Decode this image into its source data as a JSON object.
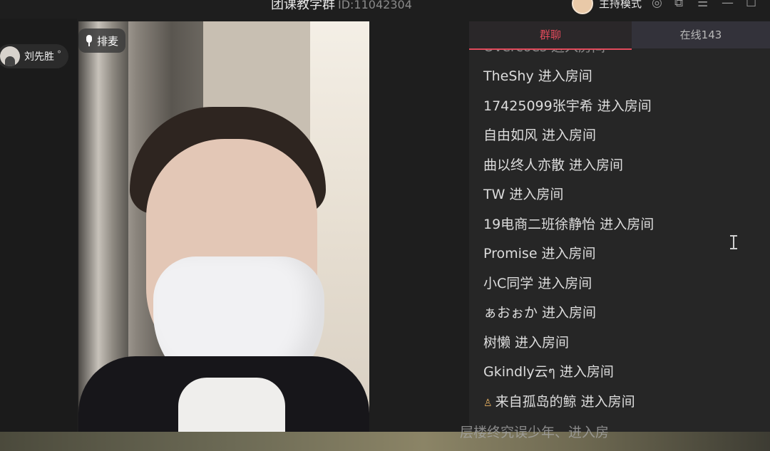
{
  "header": {
    "room_title": "团课教学群",
    "room_id": "ID:11042304",
    "host_mode": "主持模式",
    "icons": [
      "settings-icon",
      "external-icon",
      "menu-icon",
      "minimize-icon",
      "maximize-icon"
    ]
  },
  "speaker": {
    "name": "刘先胜",
    "mic_label": "排麦"
  },
  "chat": {
    "tabs": [
      {
        "label": "群聊",
        "active": true
      },
      {
        "label": "在线143",
        "active": false
      }
    ],
    "accent": "#e14a5b",
    "partial_top": "Overcoes 进入房间",
    "messages": [
      {
        "user": "TheShy",
        "action": "进入房间"
      },
      {
        "user": "17425099张宇希",
        "action": "进入房间"
      },
      {
        "user": "自由如风",
        "action": "进入房间"
      },
      {
        "user": "曲以终人亦散",
        "action": "进入房间"
      },
      {
        "user": "TW",
        "action": "进入房间"
      },
      {
        "user": "19电商二班徐静怡",
        "action": "进入房间"
      },
      {
        "user": "Promise",
        "action": "进入房间"
      },
      {
        "user": "小C同学",
        "action": "进入房间"
      },
      {
        "user": "ぁおぉか",
        "action": "进入房间"
      },
      {
        "user": "树懒",
        "action": "进入房间"
      },
      {
        "user": "Gkindly云ๆ",
        "action": "进入房间"
      },
      {
        "user": "来自孤岛的鲸",
        "action": "进入房间"
      }
    ],
    "partial_bottom": "层楼终究误少年、进入房"
  }
}
